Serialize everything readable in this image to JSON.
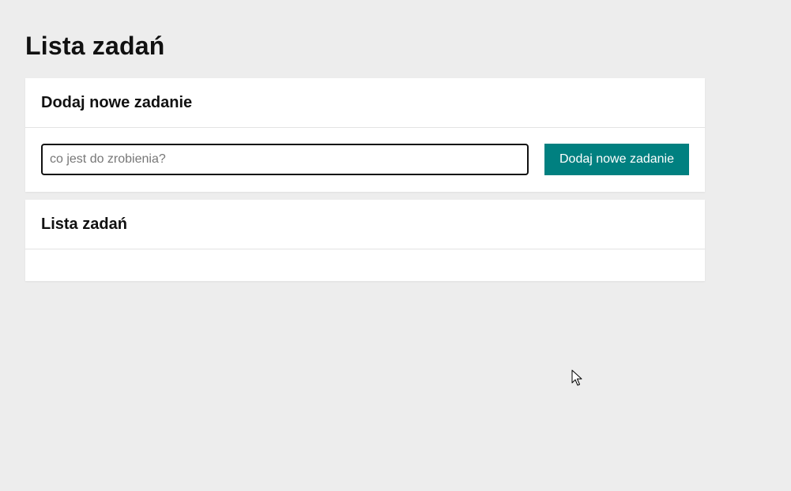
{
  "page": {
    "title": "Lista zadań"
  },
  "add_card": {
    "heading": "Dodaj nowe zadanie",
    "input_value": "",
    "input_placeholder": "co jest do zrobienia?",
    "button_label": "Dodaj nowe zadanie"
  },
  "list_card": {
    "heading": "Lista zadań",
    "tasks": []
  },
  "colors": {
    "background": "#ededed",
    "accent": "#008080",
    "card": "#ffffff"
  },
  "icons": {
    "cursor": "mouse-pointer-icon"
  }
}
